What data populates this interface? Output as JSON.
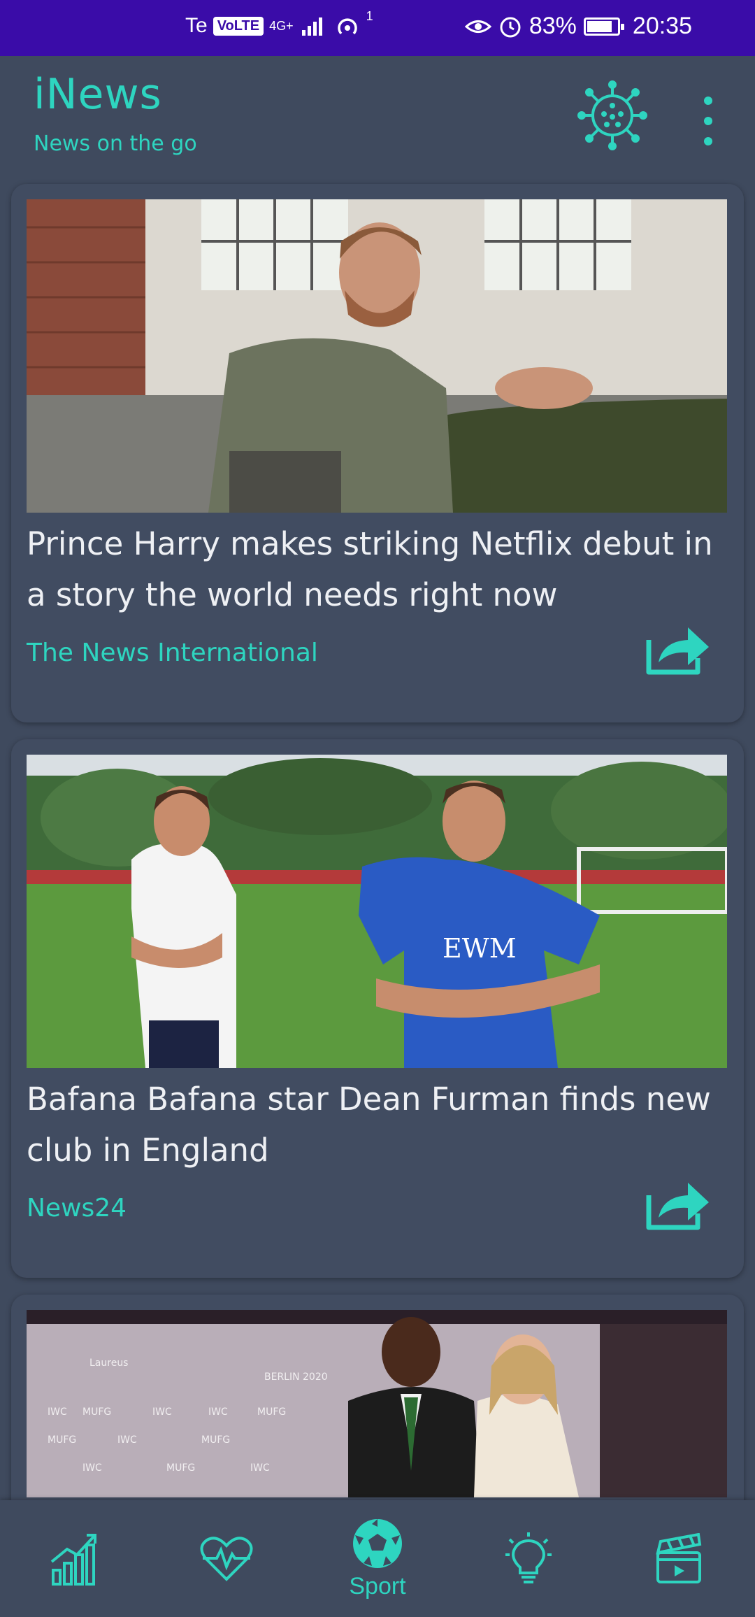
{
  "status_bar": {
    "carrier": "Te",
    "volte": "VoLTE",
    "network": "4G+",
    "wifi_badge": "1",
    "battery_percent_text": "83%",
    "battery_level": 0.83,
    "time": "20:35",
    "icons": [
      "eye-icon",
      "alarm-icon"
    ]
  },
  "app_bar": {
    "title": "iNews",
    "subtitle": "News on the go",
    "actions": [
      "virus-icon",
      "overflow-menu-icon"
    ]
  },
  "articles": [
    {
      "title": "Prince Harry makes striking Netflix debut in a story the world needs right now",
      "source": "The News International",
      "image": "man-sitting-on-green-sofa"
    },
    {
      "title": "Bafana Bafana star Dean Furman finds new club in England",
      "source": "News24",
      "image": "two-men-on-football-pitch"
    },
    {
      "title": "",
      "source": "",
      "image": "couple-at-laureus-awards"
    }
  ],
  "bottom_nav": {
    "items": [
      {
        "icon": "chart-icon",
        "label": ""
      },
      {
        "icon": "heartbeat-icon",
        "label": ""
      },
      {
        "icon": "soccer-ball-icon",
        "label": "Sport"
      },
      {
        "icon": "lightbulb-icon",
        "label": ""
      },
      {
        "icon": "video-icon",
        "label": ""
      }
    ],
    "selected": "Sport"
  },
  "colors": {
    "accent": "#2ed5c0",
    "status_bar": "#3a0ca8",
    "background": "#3f4a5e",
    "card": "#414c61"
  }
}
